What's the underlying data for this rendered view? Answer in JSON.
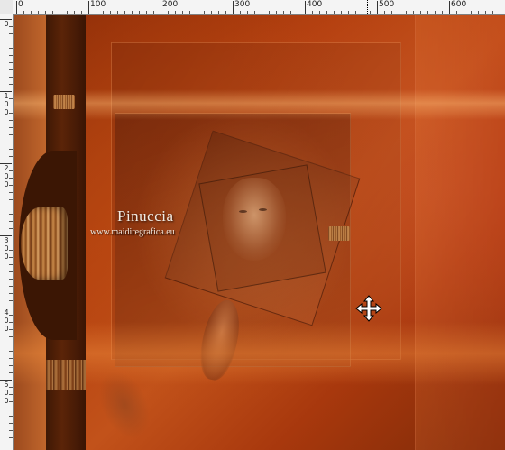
{
  "ruler": {
    "top_labels": [
      "0",
      "100",
      "200",
      "300",
      "400",
      "500",
      "600"
    ],
    "left_labels": [
      "0",
      "100",
      "200",
      "300",
      "400",
      "500"
    ]
  },
  "artwork": {
    "watermark_title": "Pinuccia",
    "watermark_url": "www.maidiregrafica.eu"
  },
  "cursor": {
    "icon": "move-cursor-icon"
  },
  "colors": {
    "canvas_base": "#b4400f",
    "ruler_bg": "#f4f4f4"
  }
}
